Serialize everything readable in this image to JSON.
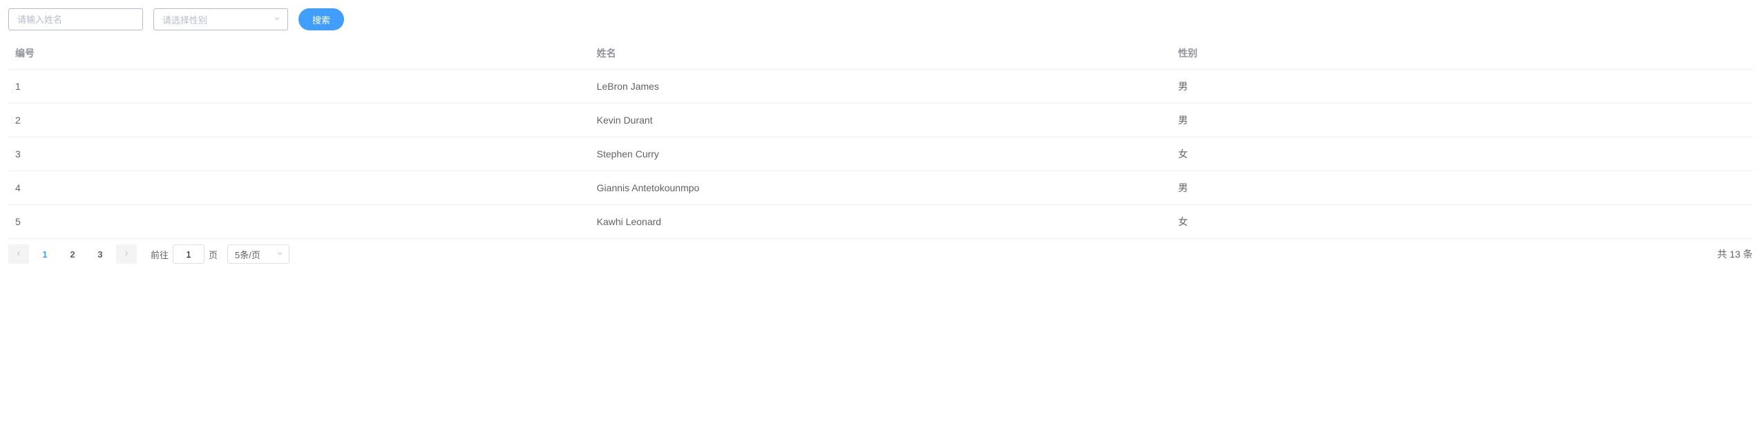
{
  "toolbar": {
    "name_placeholder": "请输入姓名",
    "gender_placeholder": "请选择性别",
    "search_label": "搜索"
  },
  "table": {
    "headers": {
      "id": "编号",
      "name": "姓名",
      "gender": "性别"
    },
    "rows": [
      {
        "id": "1",
        "name": "LeBron James",
        "gender": "男"
      },
      {
        "id": "2",
        "name": "Kevin Durant",
        "gender": "男"
      },
      {
        "id": "3",
        "name": "Stephen Curry",
        "gender": "女"
      },
      {
        "id": "4",
        "name": "Giannis Antetokounmpo",
        "gender": "男"
      },
      {
        "id": "5",
        "name": "Kawhi Leonard",
        "gender": "女"
      }
    ]
  },
  "pagination": {
    "pages": [
      "1",
      "2",
      "3"
    ],
    "current_page": "1",
    "jump_prefix": "前往",
    "jump_suffix": "页",
    "jump_value": "1",
    "size_label": "5条/页",
    "total_prefix": "共 ",
    "total_count": "13",
    "total_suffix": " 条"
  }
}
